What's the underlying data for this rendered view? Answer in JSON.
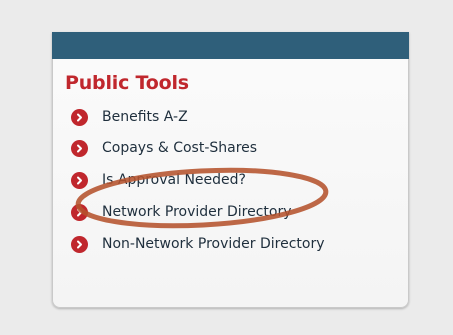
{
  "panel": {
    "title": "Public Tools",
    "header_color": "#2f5f7a",
    "accent_color": "#c0272d",
    "links": [
      {
        "label": "Benefits A-Z",
        "icon": "chevron-right-icon"
      },
      {
        "label": "Copays & Cost-Shares",
        "icon": "chevron-right-icon"
      },
      {
        "label": "Is Approval Needed?",
        "icon": "chevron-right-icon"
      },
      {
        "label": "Network Provider Directory",
        "icon": "chevron-right-icon"
      },
      {
        "label": "Non-Network Provider Directory",
        "icon": "chevron-right-icon"
      }
    ]
  },
  "annotation": {
    "highlight_color": "#b5532e",
    "highlighted_item": "Is Approval Needed?"
  }
}
